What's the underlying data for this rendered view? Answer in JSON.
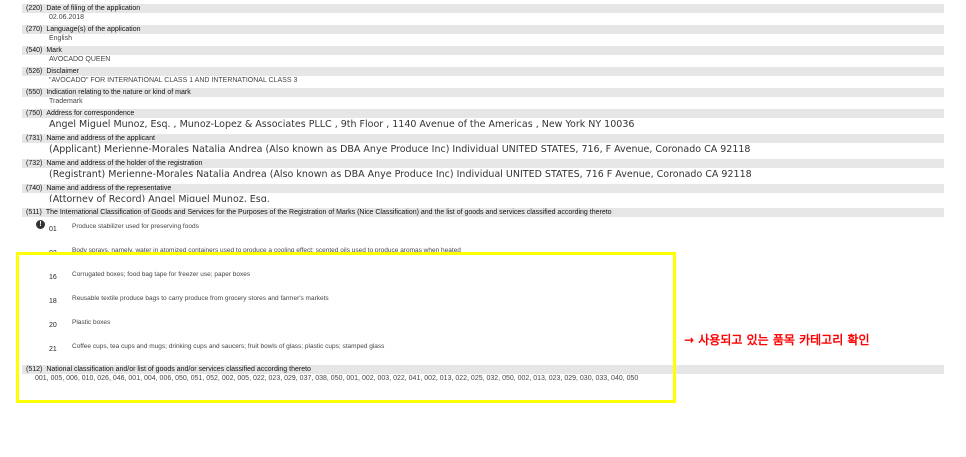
{
  "fields": [
    {
      "code": "(220)",
      "label": "Date of filing of the application",
      "value": "02.06.2018"
    },
    {
      "code": "(270)",
      "label": "Language(s) of the application",
      "value": "English"
    },
    {
      "code": "(540)",
      "label": "Mark",
      "value": "AVOCADO QUEEN"
    },
    {
      "code": "(526)",
      "label": "Disclaimer",
      "value": "\"AVOCADO\" FOR INTERNATIONAL CLASS 1 AND INTERNATIONAL CLASS 3"
    },
    {
      "code": "(550)",
      "label": "Indication relating to the nature or kind of mark",
      "value": "Trademark"
    },
    {
      "code": "(750)",
      "label": "Address for correspondence",
      "value": "Angel Miguel Munoz, Esq. , Munoz-Lopez & Associates PLLC , 9th Floor , 1140 Avenue of the Americas , New York NY 10036"
    },
    {
      "code": "(731)",
      "label": "Name and address of the applicant",
      "value": "(Applicant) Merienne-Morales Natalia Andrea (Also known as DBA Anye Produce Inc) Individual UNITED STATES, 716, F Avenue, Coronado CA 92118"
    },
    {
      "code": "(732)",
      "label": "Name and address of the holder of the registration",
      "value": "(Registrant) Merienne-Morales Natalia Andrea (Also known as DBA Anye Produce Inc) Individual UNITED STATES, 716 F Avenue, Coronado CA 92118"
    },
    {
      "code": "(740)",
      "label": "Name and address of the representative",
      "value": "(Attorney of Record) Angel Miguel Munoz, Esq."
    }
  ],
  "nice": {
    "code": "(511)",
    "label": "The International Classification of Goods and Services for the Purposes of the Registration of Marks (Nice Classification) and the list of goods and services classified according thereto",
    "icon": "info-icon",
    "icon_glyph": "!",
    "items": [
      {
        "cls": "01",
        "desc": "Produce stabilizer used for preserving foods"
      },
      {
        "cls": "03",
        "desc": "Body sprays, namely, water in atomized containers used to produce a cooling effect; scented oils used to produce aromas when heated"
      },
      {
        "cls": "16",
        "desc": "Corrugated boxes; food bag tape for freezer use; paper boxes"
      },
      {
        "cls": "18",
        "desc": "Reusable textile produce bags to carry produce from grocery stores and farmer's markets"
      },
      {
        "cls": "20",
        "desc": "Plastic boxes"
      },
      {
        "cls": "21",
        "desc": "Coffee cups, tea cups and mugs; drinking cups and saucers; fruit bowls of glass; plastic cups; stamped glass"
      }
    ]
  },
  "national": {
    "code": "(512)",
    "label": "National classification and/or list of goods and/or services classified according thereto",
    "value": "001, 005, 006, 010, 026, 046, 001, 004, 006, 050, 051, 052, 002, 005, 022, 023, 029, 037, 038, 050, 001, 002, 003, 022, 041, 002, 013, 022, 025, 032, 050, 002, 013, 023, 029, 030, 033, 040, 050"
  },
  "annotation": {
    "text": "→ 사용되고 있는 품목 카테고리 확인",
    "color": "#ff0000"
  },
  "highlight_color": "#ffff00"
}
